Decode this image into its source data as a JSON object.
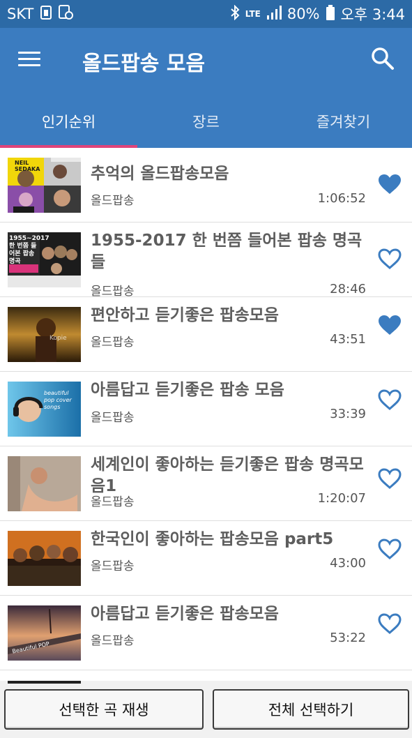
{
  "status_bar": {
    "carrier": "SKT",
    "network": "LTE",
    "battery": "80%",
    "time": "오후 3:44"
  },
  "app_bar": {
    "title": "올드팝송 모음"
  },
  "tabs": [
    {
      "label": "인기순위",
      "active": true
    },
    {
      "label": "장르",
      "active": false
    },
    {
      "label": "즐겨찾기",
      "active": false
    }
  ],
  "items": [
    {
      "title": "추억의 올드팝송모음",
      "genre": "올드팝송",
      "duration": "1:06:52",
      "favorite": true
    },
    {
      "title": "1955-2017 한 번쯤 들어본 팝송 명곡들",
      "genre": "올드팝송",
      "duration": "28:46",
      "favorite": false
    },
    {
      "title": "편안하고 듣기좋은 팝송모음",
      "genre": "올드팝송",
      "duration": "43:51",
      "favorite": true
    },
    {
      "title": "아름답고 듣기좋은 팝송 모음",
      "genre": "올드팝송",
      "duration": "33:39",
      "favorite": false
    },
    {
      "title": "세계인이 좋아하는 듣기좋은 팝송 명곡모음1",
      "genre": "올드팝송",
      "duration": "1:20:07",
      "favorite": false
    },
    {
      "title": "한국인이 좋아하는 팝송모음 part5",
      "genre": "올드팝송",
      "duration": "43:00",
      "favorite": false
    },
    {
      "title": "아름답고 듣기좋은 팝송모음",
      "genre": "올드팝송",
      "duration": "53:22",
      "favorite": false
    }
  ],
  "thumbnails": [
    {
      "text": "NEIL SEDAKA"
    },
    {
      "text": "1955~2017 한 번쯤 들어본 팝송 명곡"
    },
    {
      "text": "Kopie"
    },
    {
      "text": "beautiful pop cover songs"
    },
    {
      "text": ""
    },
    {
      "text": ""
    },
    {
      "text": "Beautiful POP"
    }
  ],
  "bottom_bar": {
    "play_selected": "선택한 곡 재생",
    "select_all": "전체 선택하기"
  },
  "colors": {
    "status_bar": "#2c6aa6",
    "app_bar": "#3b7cc0",
    "tab_indicator": "#e0447a",
    "heart": "#3b7cc0"
  }
}
